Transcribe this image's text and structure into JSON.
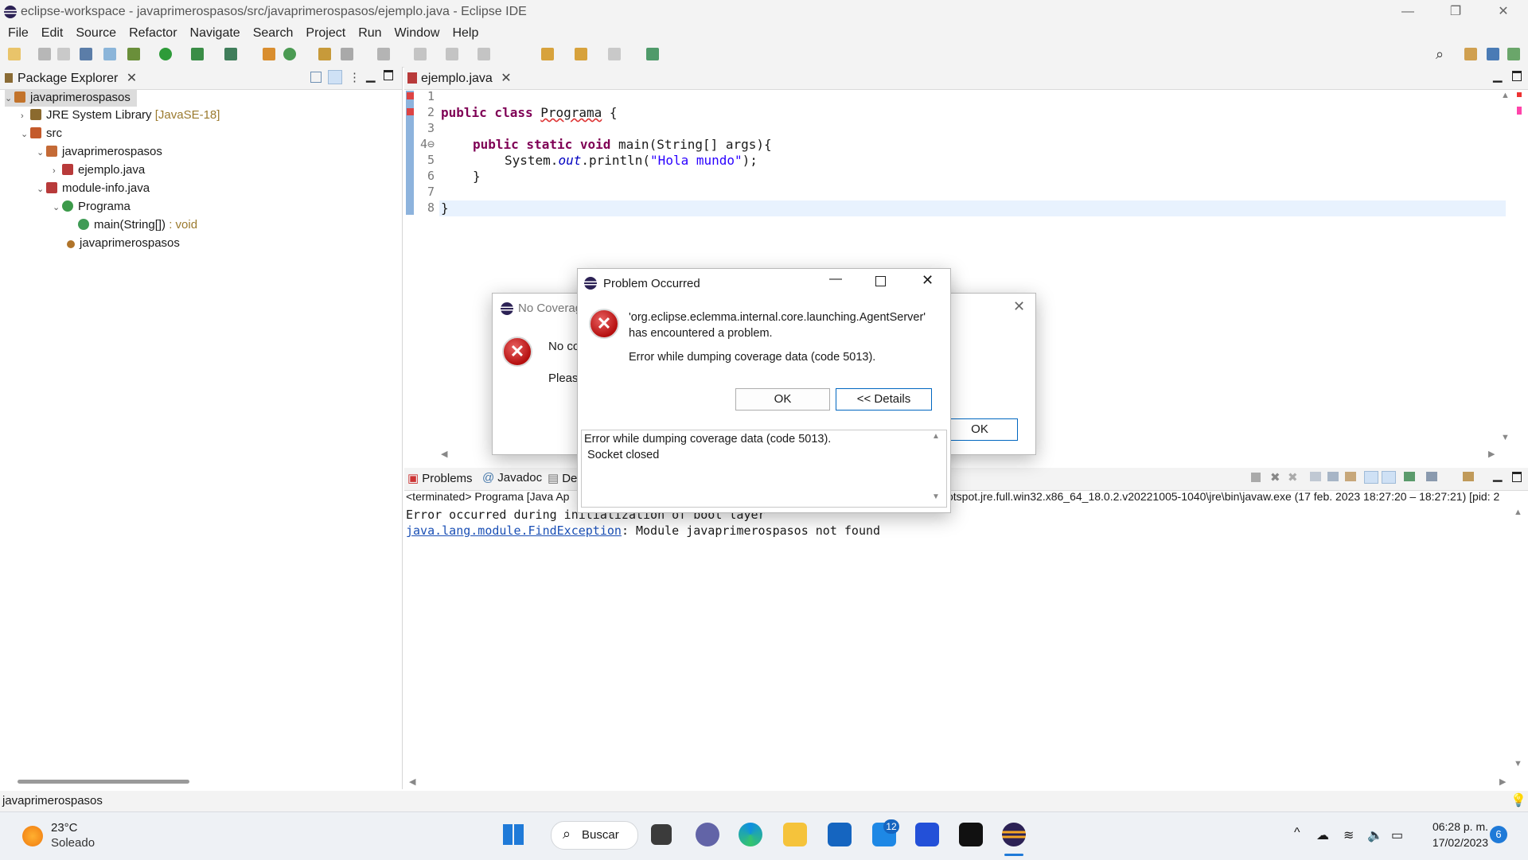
{
  "window": {
    "title": "eclipse-workspace - javaprimerospasos/src/javaprimerospasos/ejemplo.java - Eclipse IDE"
  },
  "menu": [
    "File",
    "Edit",
    "Source",
    "Refactor",
    "Navigate",
    "Search",
    "Project",
    "Run",
    "Window",
    "Help"
  ],
  "package_explorer": {
    "tab_label": "Package Explorer",
    "tree": {
      "project": "javaprimerospasos",
      "jre": "JRE System Library",
      "jre_version": "[JavaSE-18]",
      "src": "src",
      "package": "javaprimerospasos",
      "file_ejemplo": "ejemplo.java",
      "file_module": "module-info.java",
      "class_name": "Programa",
      "method": "main(String[])",
      "method_return": " : void",
      "module": "javaprimerospasos"
    }
  },
  "editor": {
    "tab_label": "ejemplo.java",
    "line_numbers": [
      "1",
      "2",
      "3",
      "4⊖",
      "5",
      "6",
      "7",
      "8"
    ],
    "code": {
      "l2_kw": "public class ",
      "l2_name": "Programa",
      "l2_brace": " {",
      "l4_kw": "public static void ",
      "l4_rest": "main(String[] args){",
      "l5_a": "System.",
      "l5_out": "out",
      "l5_b": ".println(",
      "l5_str": "\"Hola mundo\"",
      "l5_c": ");",
      "l6": "}",
      "l8": "}"
    }
  },
  "bottom_panel": {
    "tabs": [
      "Problems",
      "Javadoc",
      "De"
    ],
    "terminated_left": "<terminated> Programa [Java Ap",
    "terminated_right": "otspot.jre.full.win32.x86_64_18.0.2.v20221005-1040\\jre\\bin\\javaw.exe  (17 feb. 2023 18:27:20 – 18:27:21) [pid: 2",
    "console_line1": "Error occurred during initialization of boot layer",
    "console_exception": "java.lang.module.FindException",
    "console_line2_rest": ": Module javaprimerospasos not found"
  },
  "no_coverage_dialog": {
    "title": "No Coverag",
    "msg1": "No co",
    "msg2": "Please",
    "ok": "OK"
  },
  "problem_dialog": {
    "title": "Problem Occurred",
    "message_line1": "'org.eclipse.eclemma.internal.core.launching.AgentServer'",
    "message_line2": "has encountered a problem.",
    "detail": "Error while dumping coverage data (code 5013).",
    "ok": "OK",
    "details_button": "<< Details",
    "details_text_1": "Error while dumping coverage data (code 5013).",
    "details_text_2": " Socket closed"
  },
  "status_bar": {
    "text": "javaprimerospasos"
  },
  "taskbar": {
    "weather_temp": "23°C",
    "weather_desc": "Soleado",
    "search_label": "Buscar",
    "mail_badge": "12",
    "time": "06:28 p. m.",
    "date": "17/02/2023",
    "notif_count": "6"
  }
}
